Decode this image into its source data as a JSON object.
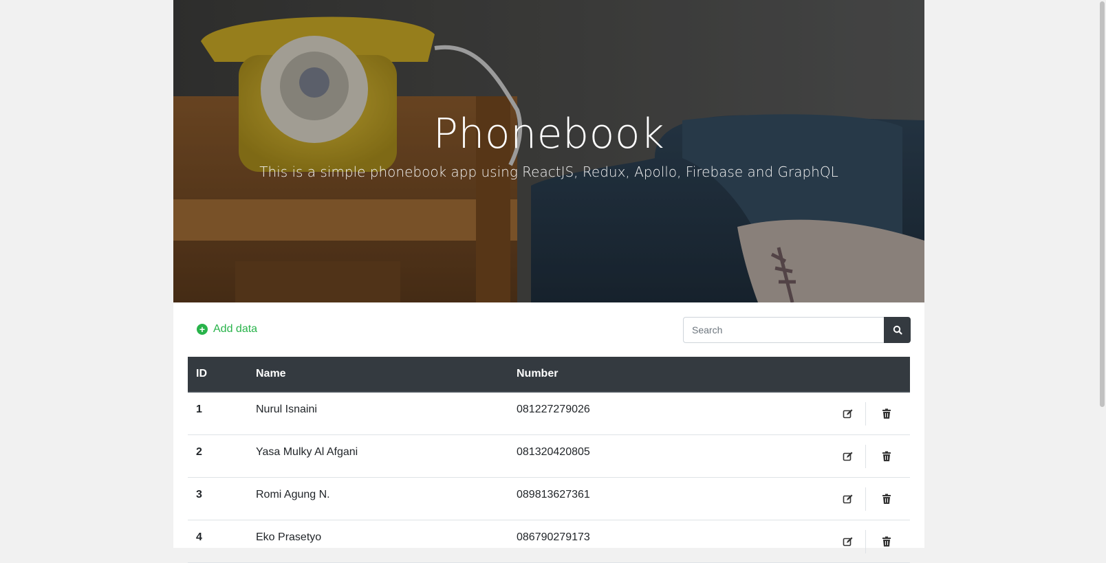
{
  "hero": {
    "title": "Phonebook",
    "subtitle": "This is a simple phonebook app using ReactJS, Redux, Apollo, Firebase and GraphQL"
  },
  "toolbar": {
    "add_label": "Add data",
    "search_placeholder": "Search"
  },
  "table": {
    "headers": [
      "ID",
      "Name",
      "Number"
    ],
    "rows": [
      {
        "id": "1",
        "name": "Nurul Isnaini",
        "number": "081227279026"
      },
      {
        "id": "2",
        "name": "Yasa Mulky Al Afgani",
        "number": "081320420805"
      },
      {
        "id": "3",
        "name": "Romi Agung N.",
        "number": "089813627361"
      },
      {
        "id": "4",
        "name": "Eko Prasetyo",
        "number": "086790279173"
      }
    ]
  },
  "colors": {
    "accent_green": "#28b34a",
    "dark": "#343a40"
  }
}
